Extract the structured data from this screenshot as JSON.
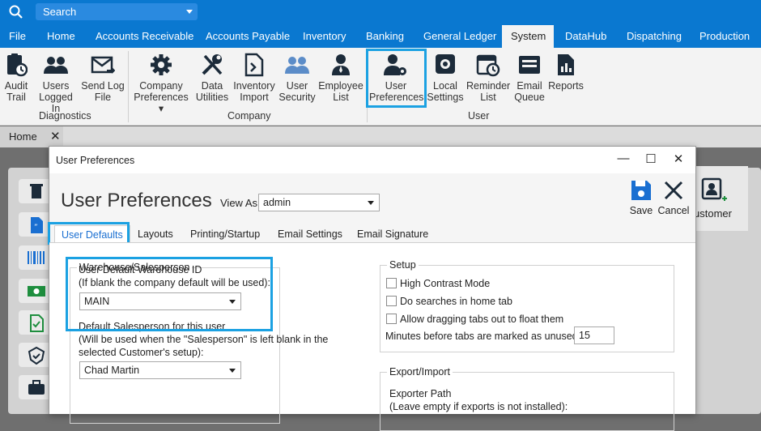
{
  "top": {
    "search_placeholder": "Search",
    "tabs": [
      "File",
      "Home",
      "Accounts Receivable",
      "Accounts Payable",
      "Inventory",
      "Banking",
      "General Ledger",
      "System",
      "DataHub",
      "Dispatching",
      "Production"
    ],
    "active_tab": "System"
  },
  "ribbon": {
    "groups": [
      "Diagnostics",
      "Company",
      "User"
    ],
    "buttons": {
      "audit_trail": [
        "Audit",
        "Trail"
      ],
      "users_logged_in": [
        "Users",
        "Logged In"
      ],
      "send_log_file": [
        "Send Log",
        "File"
      ],
      "company_preferences": [
        "Company",
        "Preferences"
      ],
      "data_utilities": [
        "Data",
        "Utilities"
      ],
      "inventory_import": [
        "Inventory",
        "Import"
      ],
      "user_security": [
        "User",
        "Security"
      ],
      "employee_list": [
        "Employee",
        "List"
      ],
      "user_preferences": [
        "User",
        "Preferences"
      ],
      "local_settings": [
        "Local",
        "Settings"
      ],
      "reminder_list": [
        "Reminder",
        "List"
      ],
      "email_queue": [
        "Email",
        "Queue"
      ],
      "reports": [
        "Reports"
      ]
    }
  },
  "doc_tabs": {
    "home": "Home",
    "close": "✕"
  },
  "background": {
    "customer_label": "ustomer"
  },
  "dialog": {
    "window_title": "User Preferences",
    "controls": {
      "minimize": "—",
      "maximize": "☐",
      "close": "✕"
    },
    "page_title": "User Preferences",
    "view_as_label": "View As:",
    "view_as_value": "admin",
    "save_label": "Save",
    "cancel_label": "Cancel",
    "tabs": [
      "User Defaults",
      "Layouts",
      "Printing/Startup",
      "Email Settings",
      "Email Signature"
    ],
    "active_tab": "User Defaults",
    "warehouse": {
      "legend": "Warehouse/Salesperson",
      "wh_label_1": "User Default Warehouse ID",
      "wh_label_2": "(If blank the company default will be used):",
      "wh_value": "MAIN",
      "sp_label_1": "Default Salesperson for this user",
      "sp_label_2": "(Will be used when the \"Salesperson\" is left blank in the",
      "sp_label_3": "selected Customer's setup):",
      "sp_value": "Chad Martin"
    },
    "setup": {
      "legend": "Setup",
      "high_contrast": "High Contrast Mode",
      "searches_home": "Do searches in home tab",
      "drag_tabs": "Allow dragging tabs out to float them",
      "minutes_label": "Minutes before tabs are marked as unused:",
      "minutes_value": "15"
    },
    "export": {
      "legend": "Export/Import",
      "path_label": "Exporter Path",
      "path_hint": "(Leave empty if exports is not installed):"
    }
  },
  "colors": {
    "accent": "#0a78d0",
    "highlight": "#1ba1e2"
  }
}
